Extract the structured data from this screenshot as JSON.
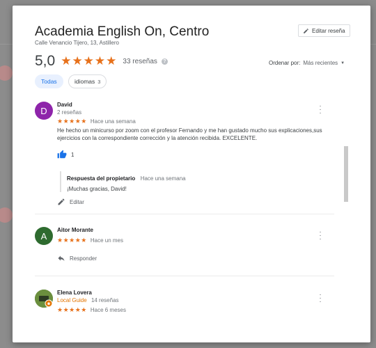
{
  "place": {
    "title": "Academia English On, Centro",
    "address": "Calle Venancio Tijero, 13, Astillero"
  },
  "edit_review_label": "Editar reseña",
  "rating": {
    "value": "5,0",
    "stars": "★★★★★",
    "count_label": "33 reseñas"
  },
  "sort": {
    "label": "Ordenar por:",
    "value": "Más recientes"
  },
  "filters": [
    {
      "label": "Todas",
      "count": ""
    },
    {
      "label": "idiomas",
      "count": "3"
    }
  ],
  "reviews": [
    {
      "avatar_letter": "D",
      "avatar_color": "#8e24aa",
      "name": "David",
      "meta": "2 reseñas",
      "stars": "★★★★★",
      "time": "Hace una semana",
      "text": "He hecho un minicurso por zoom con el profesor Fernando y me han gustado mucho sus explicaciones,sus ejercicios con la correspondiente corrección y la atención recibida. EXCELENTE.",
      "likes": "1",
      "owner_reply": {
        "label": "Respuesta del propietario",
        "time": "Hace una semana",
        "text": "¡Muchas gracias, David!"
      },
      "action": "Editar"
    },
    {
      "avatar_letter": "A",
      "avatar_color": "#2e6b2f",
      "name": "Aitor Morante",
      "stars": "★★★★★",
      "time": "Hace un mes",
      "action": "Responder"
    },
    {
      "name": "Elena Lovera",
      "meta_guide": "Local Guide",
      "meta": "14 reseñas",
      "stars": "★★★★★",
      "time": "Hace 6 meses"
    }
  ],
  "colors": {
    "star": "#e7711b",
    "accent_blue": "#1a73e8",
    "local_guide": "#e37400"
  }
}
